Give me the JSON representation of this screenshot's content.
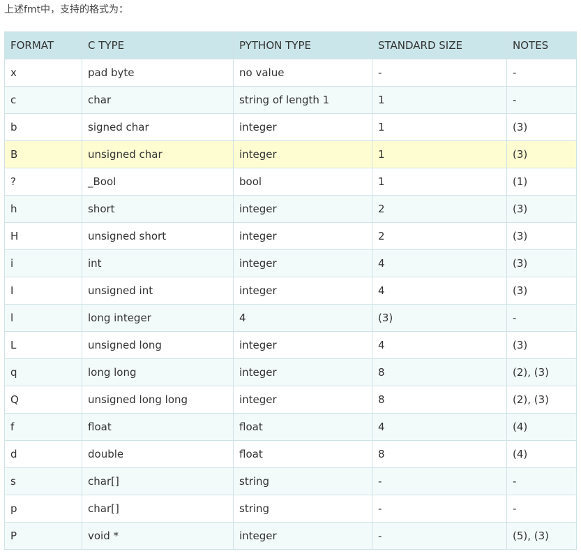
{
  "intro_text": "上述fmt中，支持的格式为：",
  "table": {
    "headers": [
      "FORMAT",
      "C TYPE",
      "PYTHON TYPE",
      "STANDARD SIZE",
      "NOTES"
    ],
    "rows": [
      [
        "x",
        "pad byte",
        "no value",
        "-",
        "-"
      ],
      [
        "c",
        "char",
        "string of length 1",
        "1",
        "-"
      ],
      [
        "b",
        "signed char",
        "integer",
        "1",
        "(3)"
      ],
      [
        "B",
        "unsigned char",
        "integer",
        "1",
        "(3)"
      ],
      [
        "?",
        "_Bool",
        "bool",
        "1",
        "(1)"
      ],
      [
        "h",
        "short",
        "integer",
        "2",
        "(3)"
      ],
      [
        "H",
        "unsigned short",
        "integer",
        "2",
        "(3)"
      ],
      [
        "i",
        "int",
        "integer",
        "4",
        "(3)"
      ],
      [
        "I",
        "unsigned int",
        "integer",
        "4",
        "(3)"
      ],
      [
        "l",
        "long integer",
        "4",
        "(3)",
        "-"
      ],
      [
        "L",
        "unsigned long",
        "integer",
        "4",
        "(3)"
      ],
      [
        "q",
        "long long",
        "integer",
        "8",
        "(2), (3)"
      ],
      [
        "Q",
        "unsigned long long",
        "integer",
        "8",
        "(2), (3)"
      ],
      [
        "f",
        "float",
        "float",
        "4",
        "(4)"
      ],
      [
        "d",
        "double",
        "float",
        "8",
        "(4)"
      ],
      [
        "s",
        "char[]",
        "string",
        "-",
        "-"
      ],
      [
        "p",
        "char[]",
        "string",
        "-",
        "-"
      ],
      [
        "P",
        "void *",
        "integer",
        "-",
        "(5), (3)"
      ]
    ],
    "highlighted_row_index": 3
  },
  "colors": {
    "header_bg": "#cbe6ea",
    "border": "#cfe3e6",
    "stripe": "#f3fafa",
    "highlight": "#fefdd2"
  }
}
